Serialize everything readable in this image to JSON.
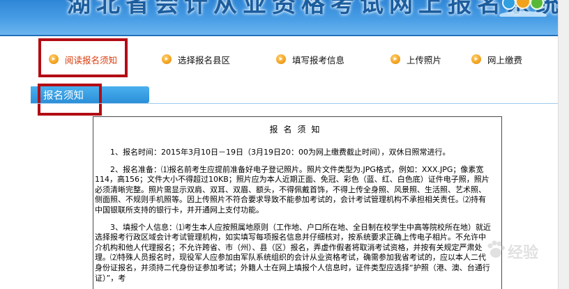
{
  "header": {
    "title": "湖北省会计从业资格考试网上报名系统"
  },
  "steps": [
    {
      "label": "阅读报名须知",
      "active": true,
      "icon": "arrow-right-icon"
    },
    {
      "label": "选择报名县区",
      "active": false,
      "icon": "arrow-right-icon"
    },
    {
      "label": "填写报考信息",
      "active": false,
      "icon": "arrow-right-icon"
    },
    {
      "label": "上传照片",
      "active": false,
      "icon": "arrow-right-icon"
    },
    {
      "label": "网上缴费",
      "active": false,
      "icon": "arrow-right-icon"
    }
  ],
  "section": {
    "title": "报名须知"
  },
  "notice": {
    "title": "报名须知",
    "paragraphs": [
      "1、报名时间：2015年3月10日－19日（3月19日20：00为网上缴费截止时间），双休日照常进行。",
      "2、报名准备：⑴报名前考生应提前准备好电子登记照片。照片文件类型为.JPG格式，例如：XXX.JPG；像素宽114，高156；文件大小不得超过10KB；照片应为本人近期正面、免冠、彩色（蓝、红、白色底）证件电子照，照片必须清晰完整。照片需显示双肩、双耳、双眉、额头，不得佩戴首饰，不得上传全身照、风景照、生活照、艺术照、侧面照、不规则手机照等。因上传照片不符合要求导致不能参加考试的，会计考试管理机构不承担相关责任。⑵持有中国银联所支持的银行卡，并开通网上支付功能。",
      "3、填报个人信息：⑴考生本人应按照属地原则（工作地、户口所在地、全日制在校学生中高等院校所在地）就近选择报考行政区域会计考试管理机构，如实填写每项报名信息并仔细核对，按系统要求正确上传电子相片。不允许中介机构和他人代理报名；不允许跨省、市（州）、县（区）报名，弄虚作假者将取消考试资格，并按有关规定严肃处理。⑵特殊人员报名时，现役军人应参加由军队系统组织的会计从业资格考试，确需参加我省考试的，应以本人二代身份证报名，并须持二代身份证参加考试；外籍人士在网上填报个人信息时，证件类型应选择“护照（港、澳、台通行证）”，考"
    ]
  },
  "watermark": {
    "text": "经验"
  },
  "colors": {
    "banner": "#3b92dc",
    "active_step": "#d93a0b",
    "highlight": "#b30c14",
    "step_icon": "#f5a623",
    "section_bar": "#2b8fd8"
  }
}
